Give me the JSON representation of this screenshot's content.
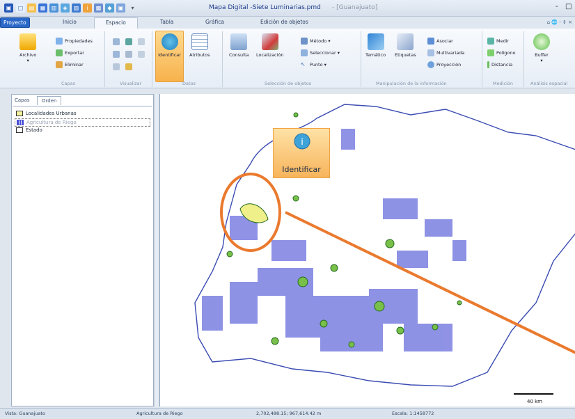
{
  "window": {
    "title": "Mapa Digital -Siete Luminarias.pmd",
    "document": "- [Guanajuato]",
    "controls": [
      "-",
      "□"
    ]
  },
  "tabs": {
    "file": "Proyecto",
    "items": [
      "Inicio",
      "Espacio",
      "Tabla",
      "Gráfica",
      "Edición de objetos"
    ],
    "right": "⌂ 🌐 - ⇕ ×"
  },
  "ribbon": {
    "archivo": "Archivo",
    "propiedades": "Propiedades",
    "exportar": "Exportar",
    "eliminar": "Eliminar",
    "capas_label": "Capas",
    "visualizar_label": "Visualizar",
    "identificar": "Identificar",
    "atributos": "Atributos",
    "datos_label": "Datos",
    "consulta": "Consulta",
    "localizacion": "Localización",
    "metodo": "Método",
    "seleccionar": "Seleccionar",
    "punto": "Punto",
    "seleccion_label": "Selección de objetos",
    "tematico": "Temático",
    "etiquetas": "Etiquetas",
    "asociar": "Asociar",
    "multivariada": "Multivariada",
    "proyeccion": "Proyección",
    "manipulacion_label": "Manipulación de la información",
    "medir": "Medir",
    "poligono": "Polígono",
    "distancia": "Distancia",
    "medicion_label": "Medición",
    "buffer": "Buffer",
    "analisis_label": "Análisis espacial"
  },
  "panel": {
    "tabs": [
      "Capas",
      "Orden"
    ],
    "layers": [
      {
        "name": "Localidades Urbanas",
        "color": "#f4f1a0"
      },
      {
        "name": "Agricultura de Riego",
        "color": "#4a4fd6"
      },
      {
        "name": "Estado",
        "color": "#ffffff"
      }
    ]
  },
  "callout": {
    "label": "Identificar"
  },
  "map": {
    "scale_label": "40 km"
  },
  "status": {
    "view": "Vista: Guanajuato",
    "layer": "Agricultura de Riego",
    "coords": "2,702,488.15; 967,614.42 m",
    "scale": "Escala: 1:1458772"
  }
}
